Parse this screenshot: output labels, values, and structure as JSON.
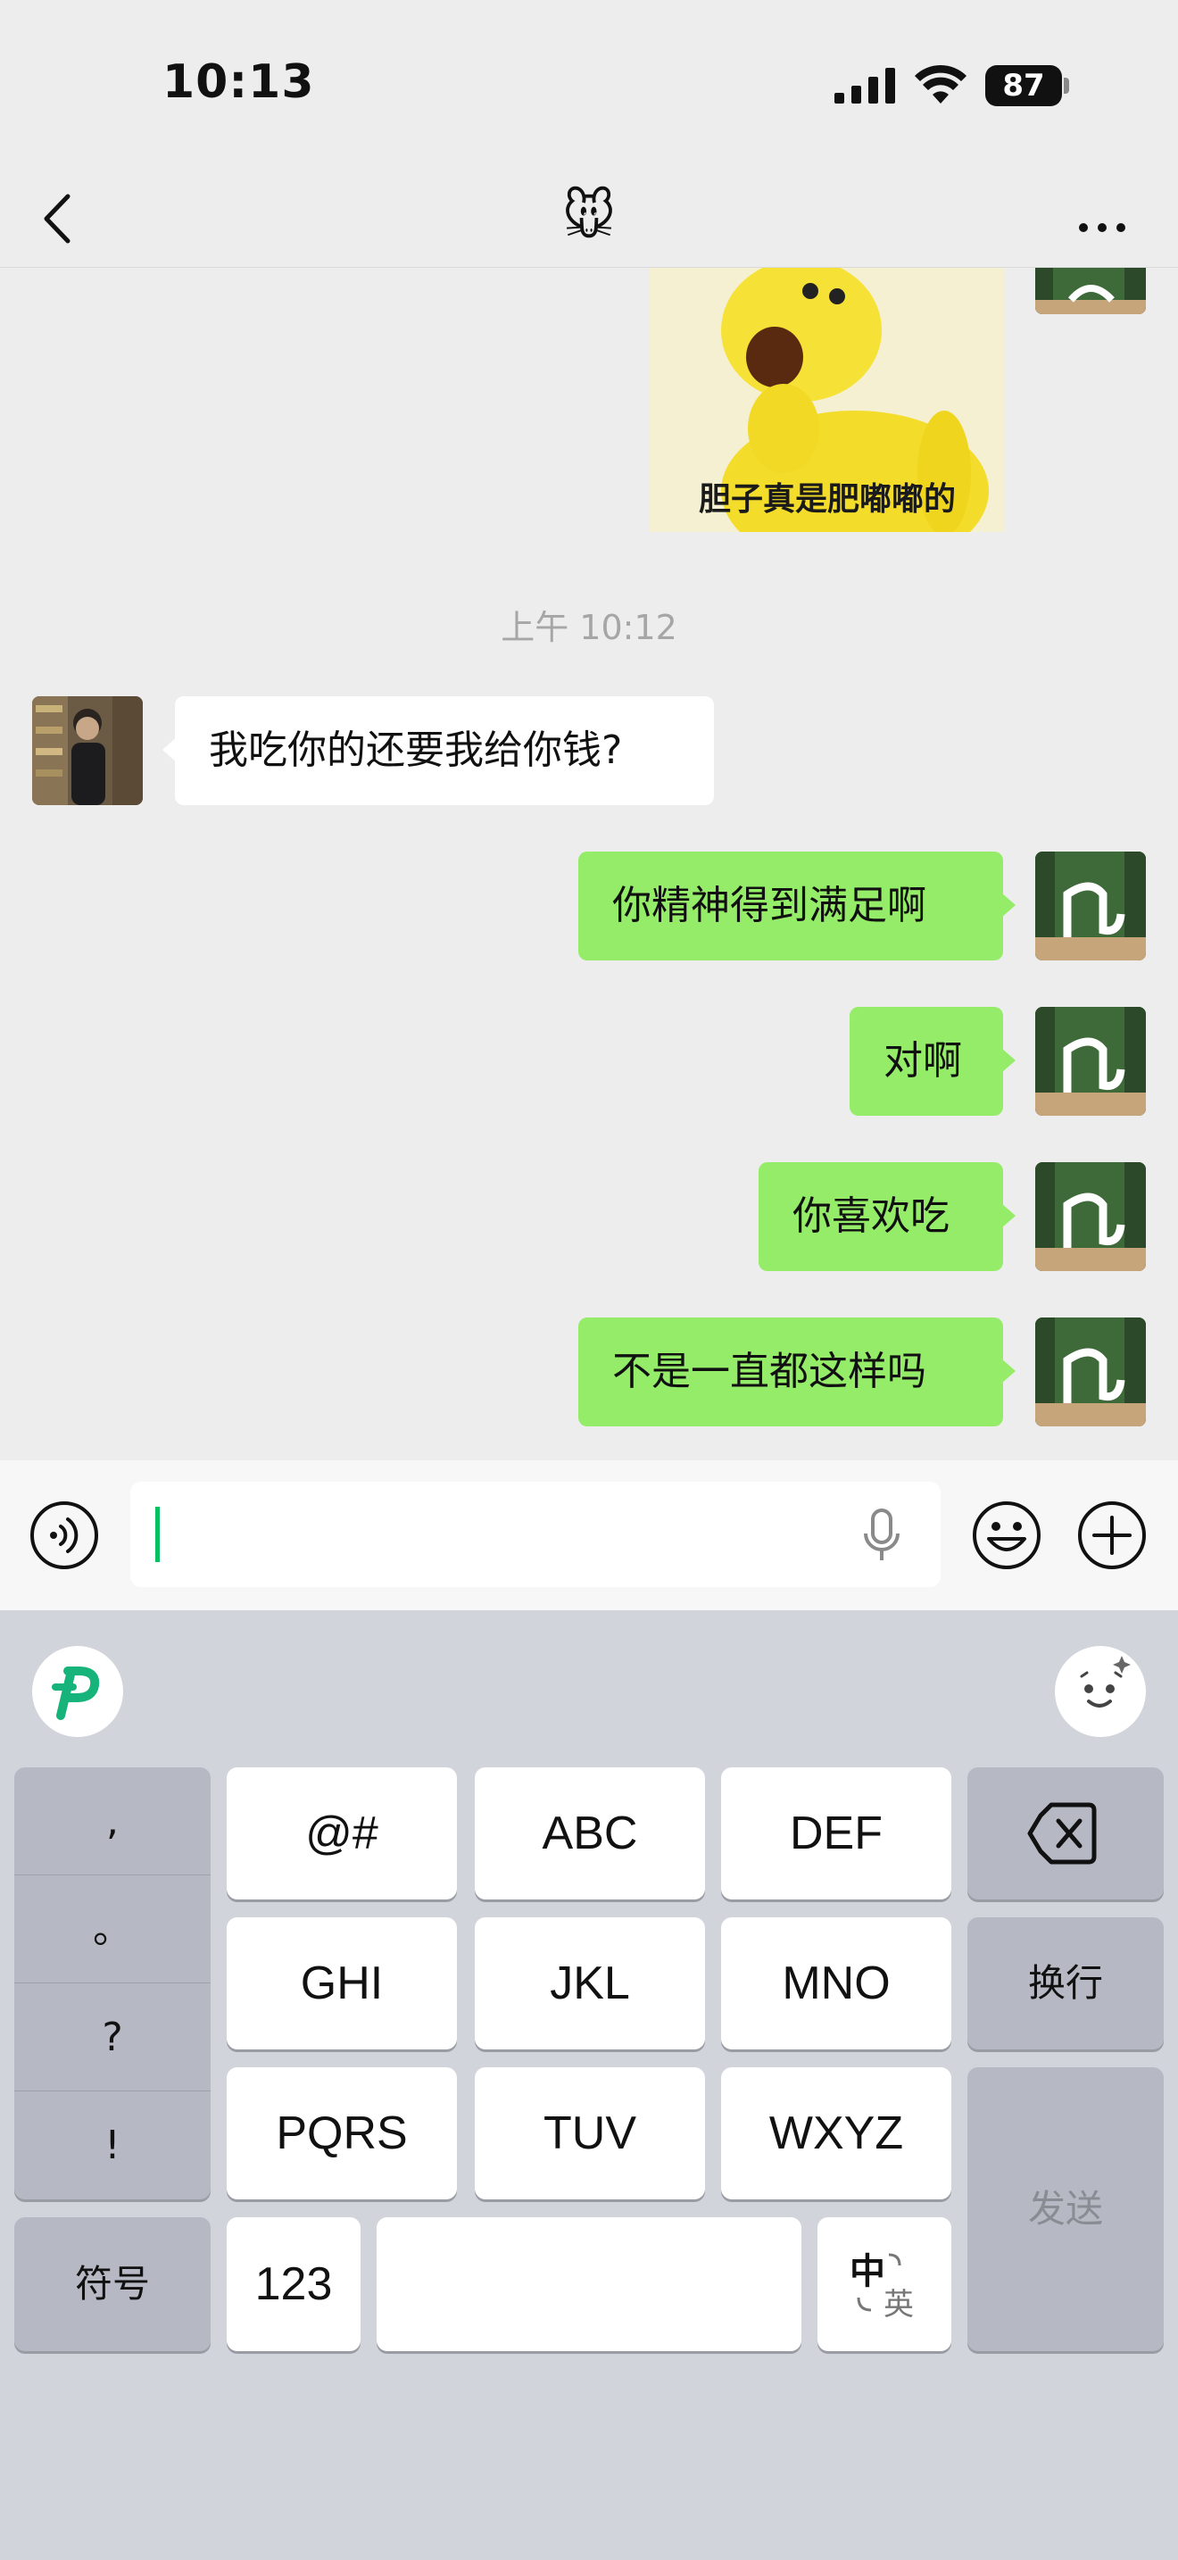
{
  "status_bar": {
    "time": "10:13",
    "battery": "87"
  },
  "nav": {
    "title_icon": "🐭",
    "back_icon": "chevron-left-icon",
    "more_icon": "ellipsis-icon"
  },
  "chat": {
    "sticker_caption": "胆子真是肥嘟嘟的",
    "timestamp": "上午 10:12",
    "messages": [
      {
        "side": "in",
        "text": "我吃你的还要我给你钱?"
      },
      {
        "side": "out",
        "text": "你精神得到满足啊"
      },
      {
        "side": "out",
        "text": "对啊"
      },
      {
        "side": "out",
        "text": "你喜欢吃"
      },
      {
        "side": "out",
        "text": "不是一直都这样吗"
      }
    ]
  },
  "input_bar": {
    "value": ""
  },
  "keyboard": {
    "punct": [
      ",",
      "。",
      "?",
      "!"
    ],
    "symbols_label": "符号",
    "row1": [
      "@#",
      "ABC",
      "DEF"
    ],
    "row2": [
      "GHI",
      "JKL",
      "MNO"
    ],
    "row3": [
      "PQRS",
      "TUV",
      "WXYZ"
    ],
    "num_label": "123",
    "switch_zh": "中",
    "switch_en": "英",
    "newline_label": "换行",
    "send_label": "发送"
  },
  "colors": {
    "bubble_out": "#95ec69",
    "bubble_in": "#ffffff",
    "caret": "#07c160",
    "background": "#ededed"
  }
}
